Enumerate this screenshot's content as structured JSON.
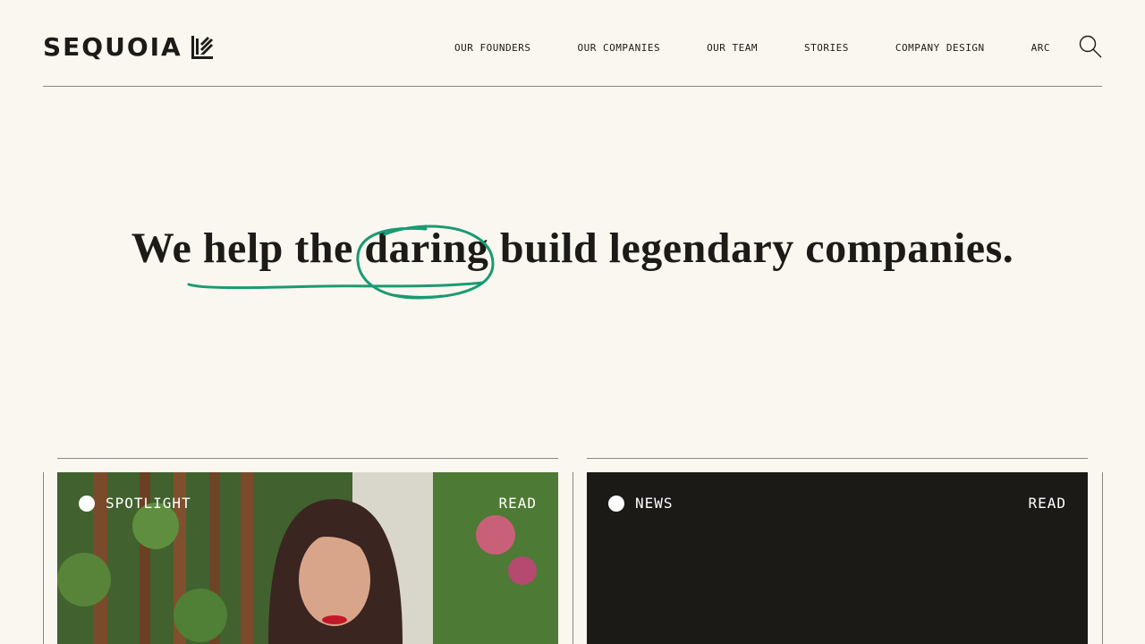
{
  "brand": {
    "name": "SEQUOIA"
  },
  "nav": {
    "items": [
      {
        "label": "OUR FOUNDERS"
      },
      {
        "label": "OUR COMPANIES"
      },
      {
        "label": "OUR TEAM"
      },
      {
        "label": "STORIES"
      },
      {
        "label": "COMPANY DESIGN"
      },
      {
        "label": "ARC"
      }
    ],
    "search_icon": "search-icon"
  },
  "hero": {
    "part1": "We ",
    "part2": "help the ",
    "part3": "daring",
    "part4": " build legendary companies.",
    "accent_color": "#1a9a73"
  },
  "cards": [
    {
      "tag": "SPOTLIGHT",
      "action": "READ"
    },
    {
      "tag": "NEWS",
      "action": "READ"
    }
  ]
}
